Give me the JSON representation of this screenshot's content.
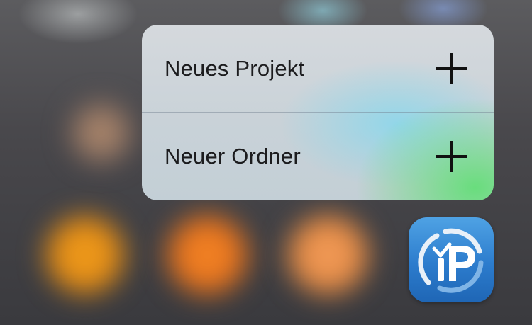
{
  "quick_actions": {
    "items": [
      {
        "label": "Neues Projekt",
        "icon": "plus-icon"
      },
      {
        "label": "Neuer Ordner",
        "icon": "plus-icon"
      }
    ]
  },
  "app_icon": {
    "logo_text": "iP",
    "icon": "app-logo-icon"
  },
  "colors": {
    "accent_green": "#64de78",
    "accent_cyan": "#8cd7eb",
    "app_blue": "#2c7ccd",
    "label_text": "#1c1c1e"
  }
}
